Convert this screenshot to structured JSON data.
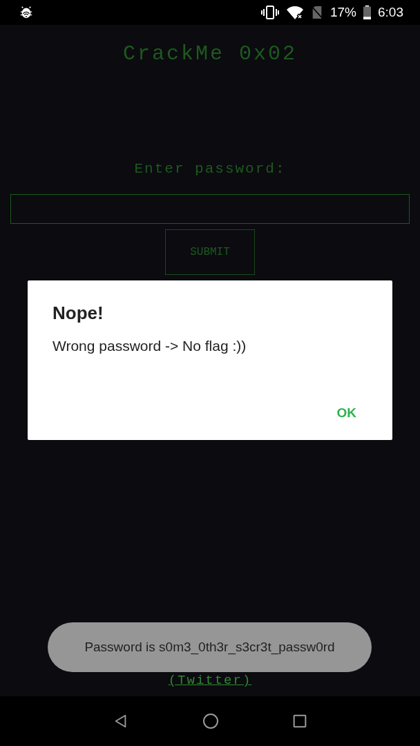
{
  "status_bar": {
    "battery": "17%",
    "time": "6:03"
  },
  "app": {
    "title": "CrackMe 0x02",
    "prompt": "Enter password:",
    "submit_button": "SUBMIT",
    "credit_link": "(Twitter)"
  },
  "dialog": {
    "title": "Nope!",
    "message": "Wrong password -> No flag :))",
    "buttons": [
      "OK"
    ]
  },
  "toast": {
    "message": "Password is s0m3_0th3r_s3cr3t_passw0rd"
  }
}
